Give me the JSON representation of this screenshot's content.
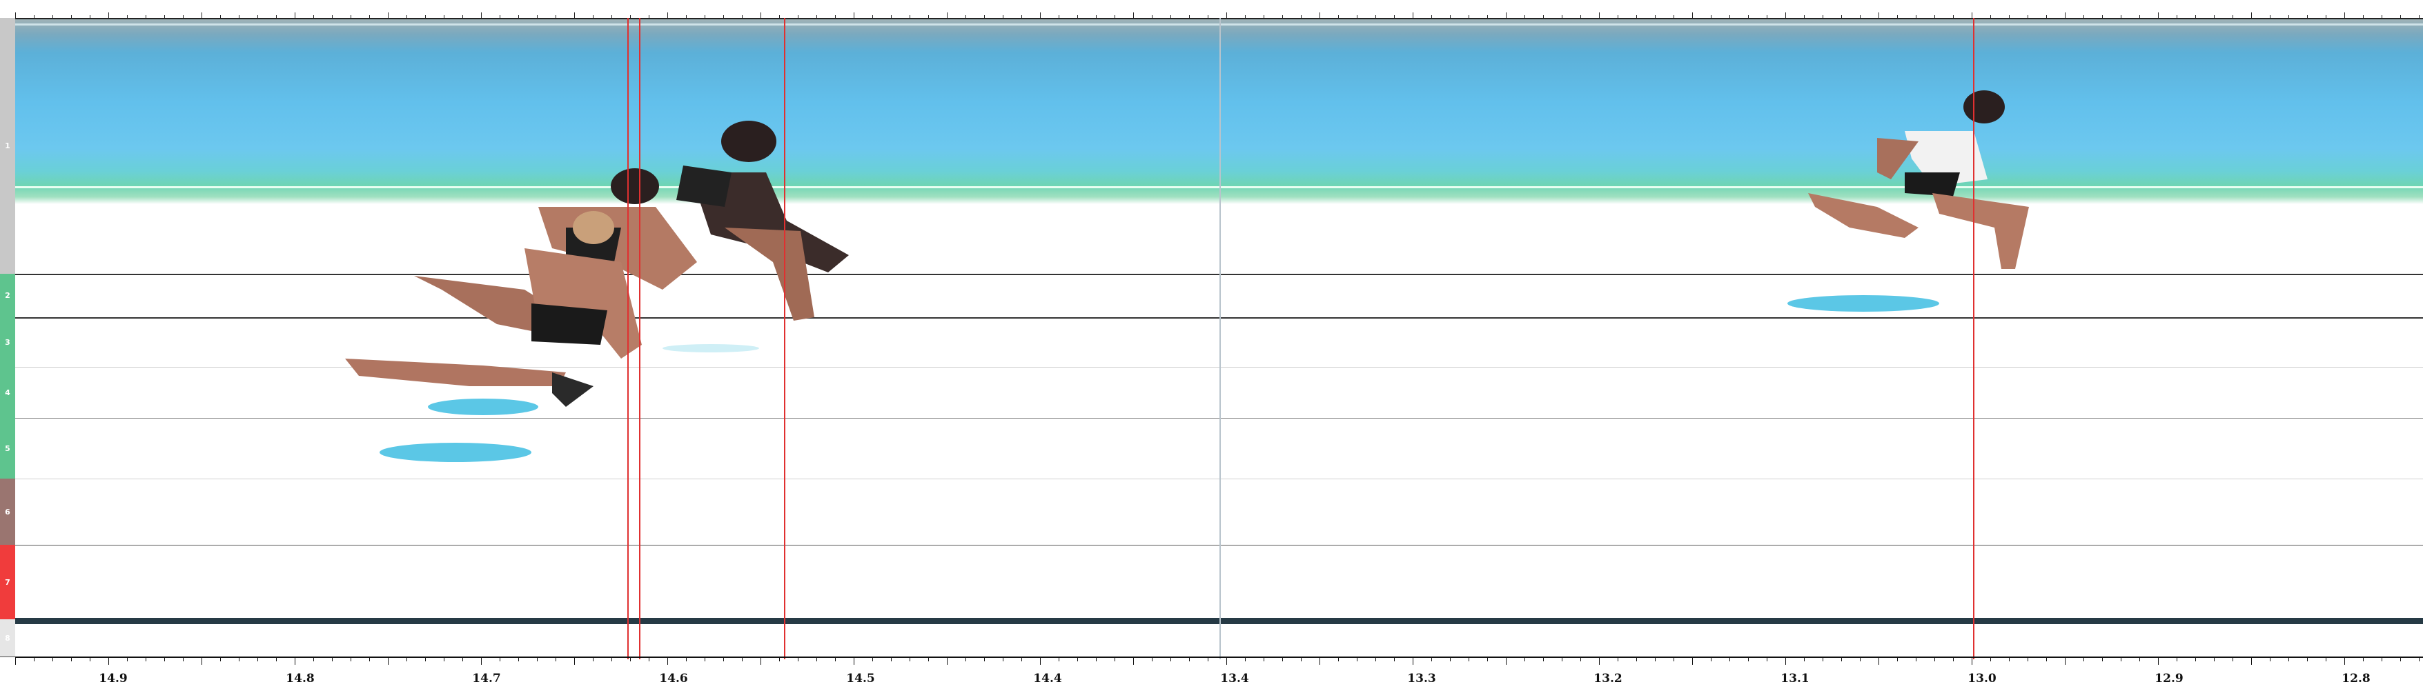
{
  "lanes": [
    {
      "number": "1",
      "color": "#c8c8c8"
    },
    {
      "number": "2",
      "color": "#5ec48e"
    },
    {
      "number": "3",
      "color": "#5ec48e"
    },
    {
      "number": "4",
      "color": "#5ec48e"
    },
    {
      "number": "5",
      "color": "#5ec48e"
    },
    {
      "number": "6",
      "color": "#9a7570"
    },
    {
      "number": "7",
      "color": "#f03c3c"
    },
    {
      "number": "8",
      "color": "#e6e6e6"
    }
  ],
  "time_axis": {
    "labels": [
      "14.9",
      "14.8",
      "14.7",
      "14.6",
      "14.5",
      "14.4",
      "13.4",
      "13.3",
      "13.2",
      "13.1",
      "13.0",
      "12.9",
      "12.8"
    ]
  },
  "colors": {
    "marker_line": "#e03030",
    "split_line": "#b8c4cc",
    "sky": "#62c0ec"
  }
}
